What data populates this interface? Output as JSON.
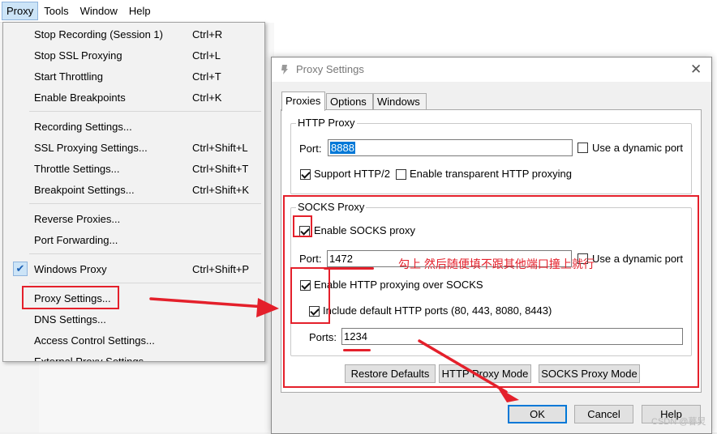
{
  "menubar": {
    "items": [
      "Proxy",
      "Tools",
      "Window",
      "Help"
    ]
  },
  "proxy_menu": {
    "items": [
      {
        "label": "Stop Recording (Session 1)",
        "shortcut": "Ctrl+R"
      },
      {
        "label": "Stop SSL Proxying",
        "shortcut": "Ctrl+L"
      },
      {
        "label": "Start Throttling",
        "shortcut": "Ctrl+T"
      },
      {
        "label": "Enable Breakpoints",
        "shortcut": "Ctrl+K"
      },
      {
        "label": "Recording Settings...",
        "shortcut": ""
      },
      {
        "label": "SSL Proxying Settings...",
        "shortcut": "Ctrl+Shift+L"
      },
      {
        "label": "Throttle Settings...",
        "shortcut": "Ctrl+Shift+T"
      },
      {
        "label": "Breakpoint Settings...",
        "shortcut": "Ctrl+Shift+K"
      },
      {
        "label": "Reverse Proxies...",
        "shortcut": ""
      },
      {
        "label": "Port Forwarding...",
        "shortcut": ""
      },
      {
        "label": "Windows Proxy",
        "shortcut": "Ctrl+Shift+P",
        "checked": true
      },
      {
        "label": "Proxy Settings...",
        "shortcut": ""
      },
      {
        "label": "DNS Settings...",
        "shortcut": ""
      },
      {
        "label": "Access Control Settings...",
        "shortcut": ""
      },
      {
        "label": "External Proxy Settings...",
        "shortcut": ""
      }
    ]
  },
  "dialog": {
    "title": "Proxy Settings",
    "close_glyph": "✕",
    "tabs": [
      "Proxies",
      "Options",
      "Windows"
    ],
    "http_proxy": {
      "group_label": "HTTP Proxy",
      "port_label": "Port:",
      "port_value": "8888",
      "dynamic_port_label": "Use a dynamic port",
      "dynamic_port_checked": false,
      "support_http2_label": "Support HTTP/2",
      "support_http2_checked": true,
      "transparent_label": "Enable transparent HTTP proxying",
      "transparent_checked": false
    },
    "socks_proxy": {
      "group_label": "SOCKS Proxy",
      "enable_label": "Enable SOCKS proxy",
      "enable_checked": true,
      "port_label": "Port:",
      "port_value": "1472",
      "dynamic_port_label": "Use a dynamic port",
      "dynamic_port_checked": false,
      "http_over_socks_label": "Enable HTTP proxying over SOCKS",
      "http_over_socks_checked": true,
      "include_default_ports_label": "Include default HTTP ports (80, 443, 8080, 8443)",
      "include_default_ports_checked": true,
      "ports_label": "Ports:",
      "ports_value": "1234"
    },
    "mode_buttons": [
      "Restore Defaults",
      "HTTP Proxy Mode",
      "SOCKS Proxy Mode"
    ],
    "footer_buttons": {
      "ok": "OK",
      "cancel": "Cancel",
      "help": "Help"
    }
  },
  "annotations": {
    "note": "勾上  然后随便填不跟其他端口撞上就行",
    "color": "#e4202b"
  },
  "watermark": "CSDN @暮炅",
  "colors": {
    "selection": "#0078d7",
    "menu_highlight": "#cce4f7",
    "annotation_red": "#e4202b"
  }
}
